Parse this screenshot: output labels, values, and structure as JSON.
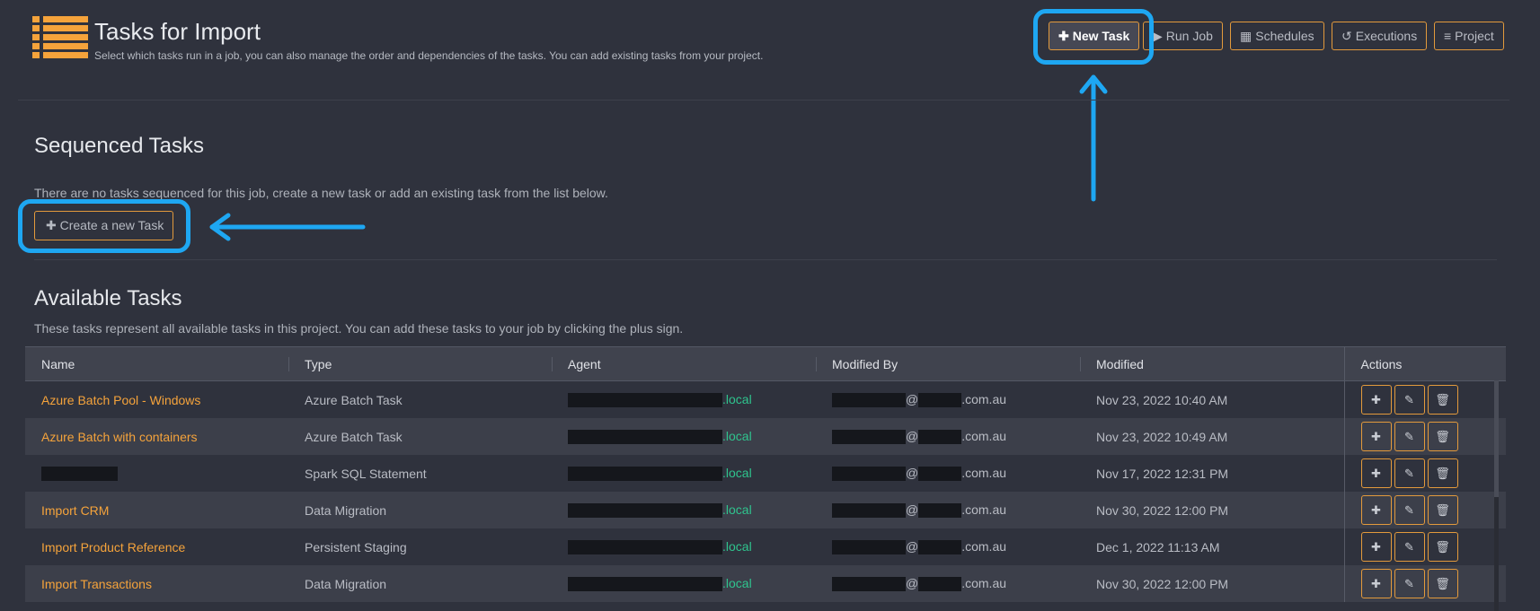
{
  "header": {
    "title": "Tasks for Import",
    "subtitle": "Select which tasks run in a job, you can also manage the order and dependencies of the tasks. You can add existing tasks from your project."
  },
  "toolbar": {
    "new_task": "New Task",
    "run_job": "Run Job",
    "schedules": "Schedules",
    "executions": "Executions",
    "project": "Project"
  },
  "sequenced": {
    "heading": "Sequenced Tasks",
    "empty_note": "There are no tasks sequenced for this job, create a new task or add an existing task from the list below.",
    "create_label": "Create a new Task"
  },
  "available": {
    "heading": "Available Tasks",
    "note": "These tasks represent all available tasks in this project. You can add these tasks to your job by clicking the plus sign.",
    "columns": [
      "Name",
      "Type",
      "Agent",
      "Modified By",
      "Modified",
      "Actions"
    ],
    "rows": [
      {
        "name": "Azure Batch Pool - Windows",
        "type": "Azure Batch Task",
        "agent_suffix": ".local",
        "at": "@",
        "domain_suffix": ".com.au",
        "modified": "Nov 23, 2022 10:40 AM"
      },
      {
        "name": "Azure Batch with containers",
        "type": "Azure Batch Task",
        "agent_suffix": ".local",
        "at": "@",
        "domain_suffix": ".com.au",
        "modified": "Nov 23, 2022 10:49 AM"
      },
      {
        "name": "",
        "type": "Spark SQL Statement",
        "agent_suffix": ".local",
        "at": "@",
        "domain_suffix": ".com.au",
        "modified": "Nov 17, 2022 12:31 PM"
      },
      {
        "name": "Import CRM",
        "type": "Data Migration",
        "agent_suffix": ".local",
        "at": "@",
        "domain_suffix": ".com.au",
        "modified": "Nov 30, 2022 12:00 PM"
      },
      {
        "name": "Import Product Reference",
        "type": "Persistent Staging",
        "agent_suffix": ".local",
        "at": "@",
        "domain_suffix": ".com.au",
        "modified": "Dec 1, 2022 11:13 AM"
      },
      {
        "name": "Import Transactions",
        "type": "Data Migration",
        "agent_suffix": ".local",
        "at": "@",
        "domain_suffix": ".com.au",
        "modified": "Nov 30, 2022 12:00 PM"
      }
    ]
  },
  "colors": {
    "accent": "#f5a33b",
    "highlight": "#1ea7f2",
    "agent_green": "#2fc48e",
    "background": "#2f323d"
  },
  "icons": [
    "list-logo-icon",
    "plus-icon",
    "play-circle-icon",
    "calendar-icon",
    "history-icon",
    "bars-icon",
    "edit-icon",
    "trash-icon"
  ]
}
